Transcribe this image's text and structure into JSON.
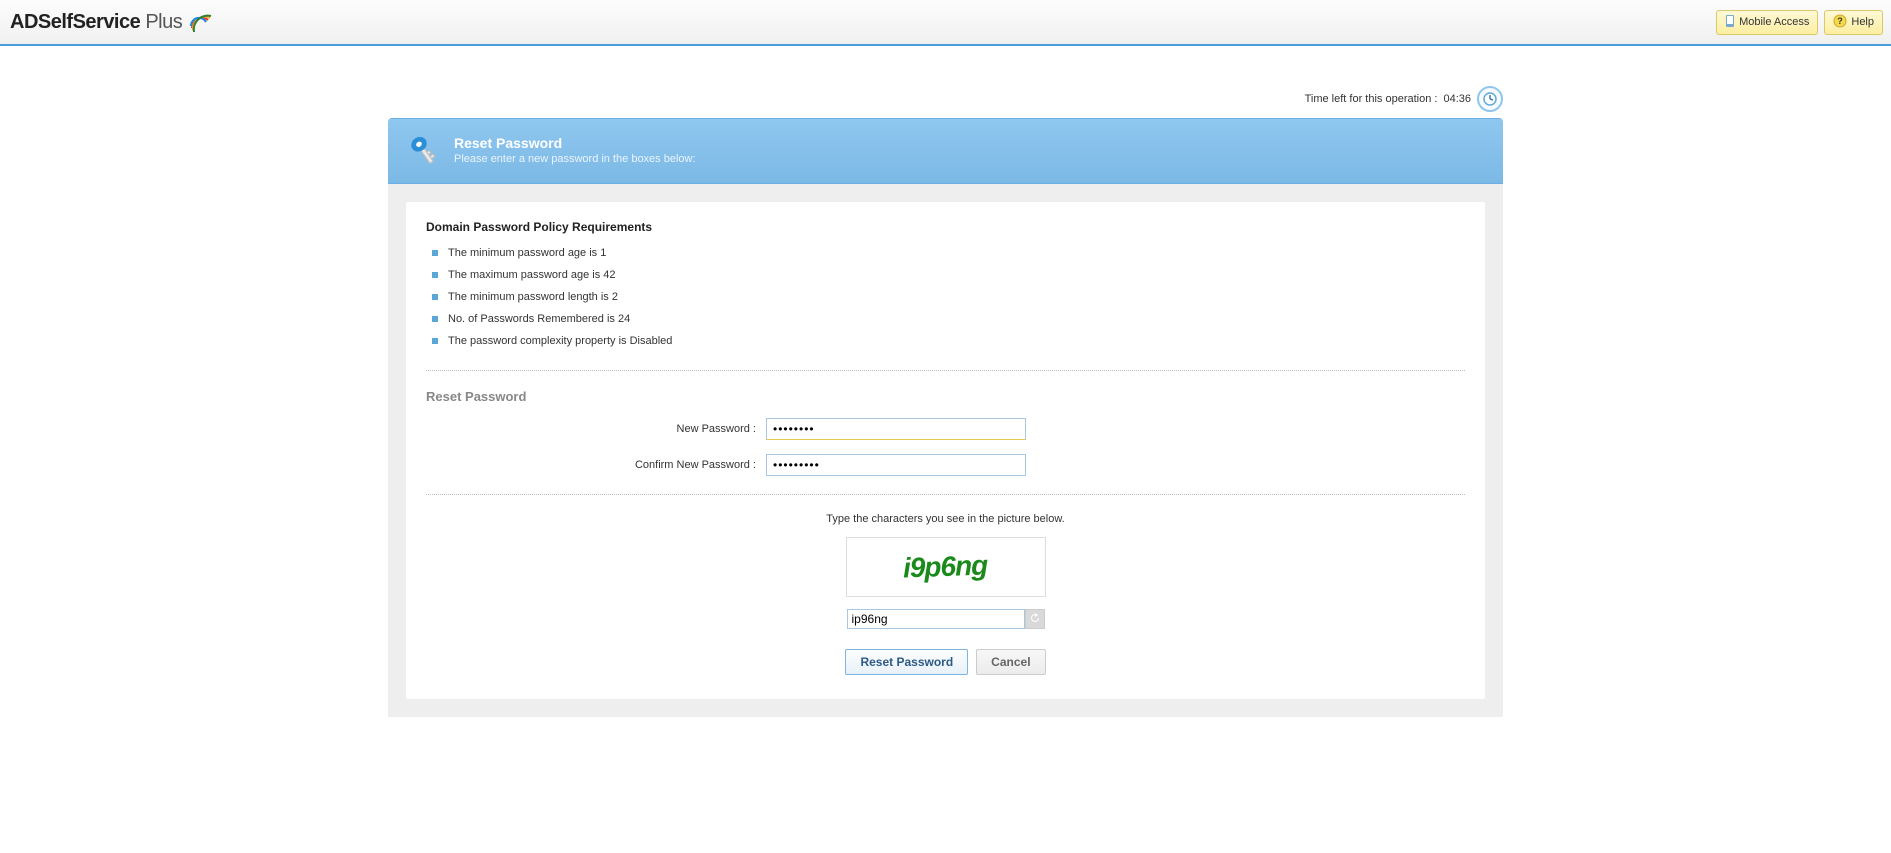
{
  "brand": {
    "name_main": "ADSelfService",
    "name_suffix": "Plus"
  },
  "top_actions": {
    "mobile_access": "Mobile Access",
    "help": "Help"
  },
  "timer": {
    "label": "Time left for this operation :",
    "value": "04:36"
  },
  "panel": {
    "title": "Reset Password",
    "subtitle": "Please enter a new password in the boxes below:"
  },
  "policy": {
    "heading": "Domain Password Policy Requirements",
    "items": [
      "The minimum password age is 1",
      "The maximum password age is 42",
      "The minimum password length is 2",
      "No. of Passwords Remembered is 24",
      "The password complexity property is Disabled"
    ]
  },
  "form": {
    "section_title": "Reset Password",
    "new_password_label": "New Password :",
    "new_password_value": "••••••••",
    "confirm_password_label": "Confirm New Password :",
    "confirm_password_value": "•••••••••"
  },
  "captcha": {
    "instruction": "Type the characters you see in the picture below.",
    "image_text": "i9p6ng",
    "input_value": "ip96ng"
  },
  "actions": {
    "reset": "Reset Password",
    "cancel": "Cancel"
  }
}
